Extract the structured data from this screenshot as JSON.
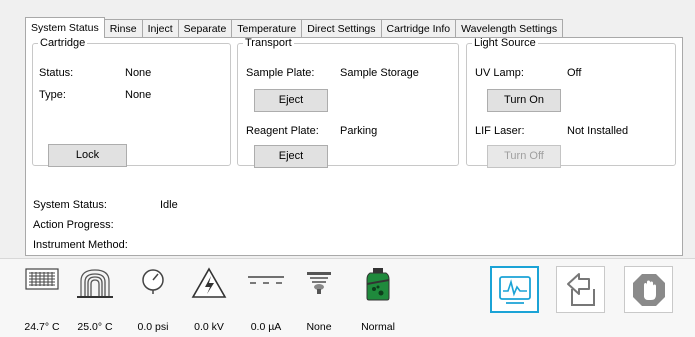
{
  "tabs": [
    {
      "label": "System Status",
      "active": true
    },
    {
      "label": "Rinse"
    },
    {
      "label": "Inject"
    },
    {
      "label": "Separate"
    },
    {
      "label": "Temperature"
    },
    {
      "label": "Direct Settings"
    },
    {
      "label": "Cartridge Info"
    },
    {
      "label": "Wavelength Settings"
    }
  ],
  "cartridge": {
    "title": "Cartridge",
    "status_label": "Status:",
    "status_value": "None",
    "type_label": "Type:",
    "type_value": "None",
    "lock_button": "Lock"
  },
  "transport": {
    "title": "Transport",
    "sample_label": "Sample Plate:",
    "sample_value": "Sample Storage",
    "sample_button": "Eject",
    "reagent_label": "Reagent Plate:",
    "reagent_value": "Parking",
    "reagent_button": "Eject"
  },
  "light_source": {
    "title": "Light Source",
    "uv_label": "UV Lamp:",
    "uv_value": "Off",
    "uv_button": "Turn On",
    "lif_label": "LIF Laser:",
    "lif_value": "Not Installed",
    "lif_button": "Turn Off"
  },
  "system": {
    "status_label": "System Status:",
    "status_value": "Idle",
    "progress_label": "Action Progress:",
    "method_label": "Instrument Method:"
  },
  "indicators": [
    {
      "icon": "cartridge-temperature-icon",
      "value": "24.7° C"
    },
    {
      "icon": "sample-temperature-icon",
      "value": "25.0° C"
    },
    {
      "icon": "pressure-gauge-icon",
      "value": "0.0 psi"
    },
    {
      "icon": "high-voltage-icon",
      "value": "0.0 kV"
    },
    {
      "icon": "current-icon",
      "value": "0.0 µA"
    },
    {
      "icon": "lamp-icon",
      "value": "None"
    },
    {
      "icon": "reagent-bottle-icon",
      "value": "Normal"
    }
  ],
  "colors": {
    "accent": "#1ba3d6",
    "stop": "#8a8a8a",
    "bottle": "#1f8a3c"
  }
}
